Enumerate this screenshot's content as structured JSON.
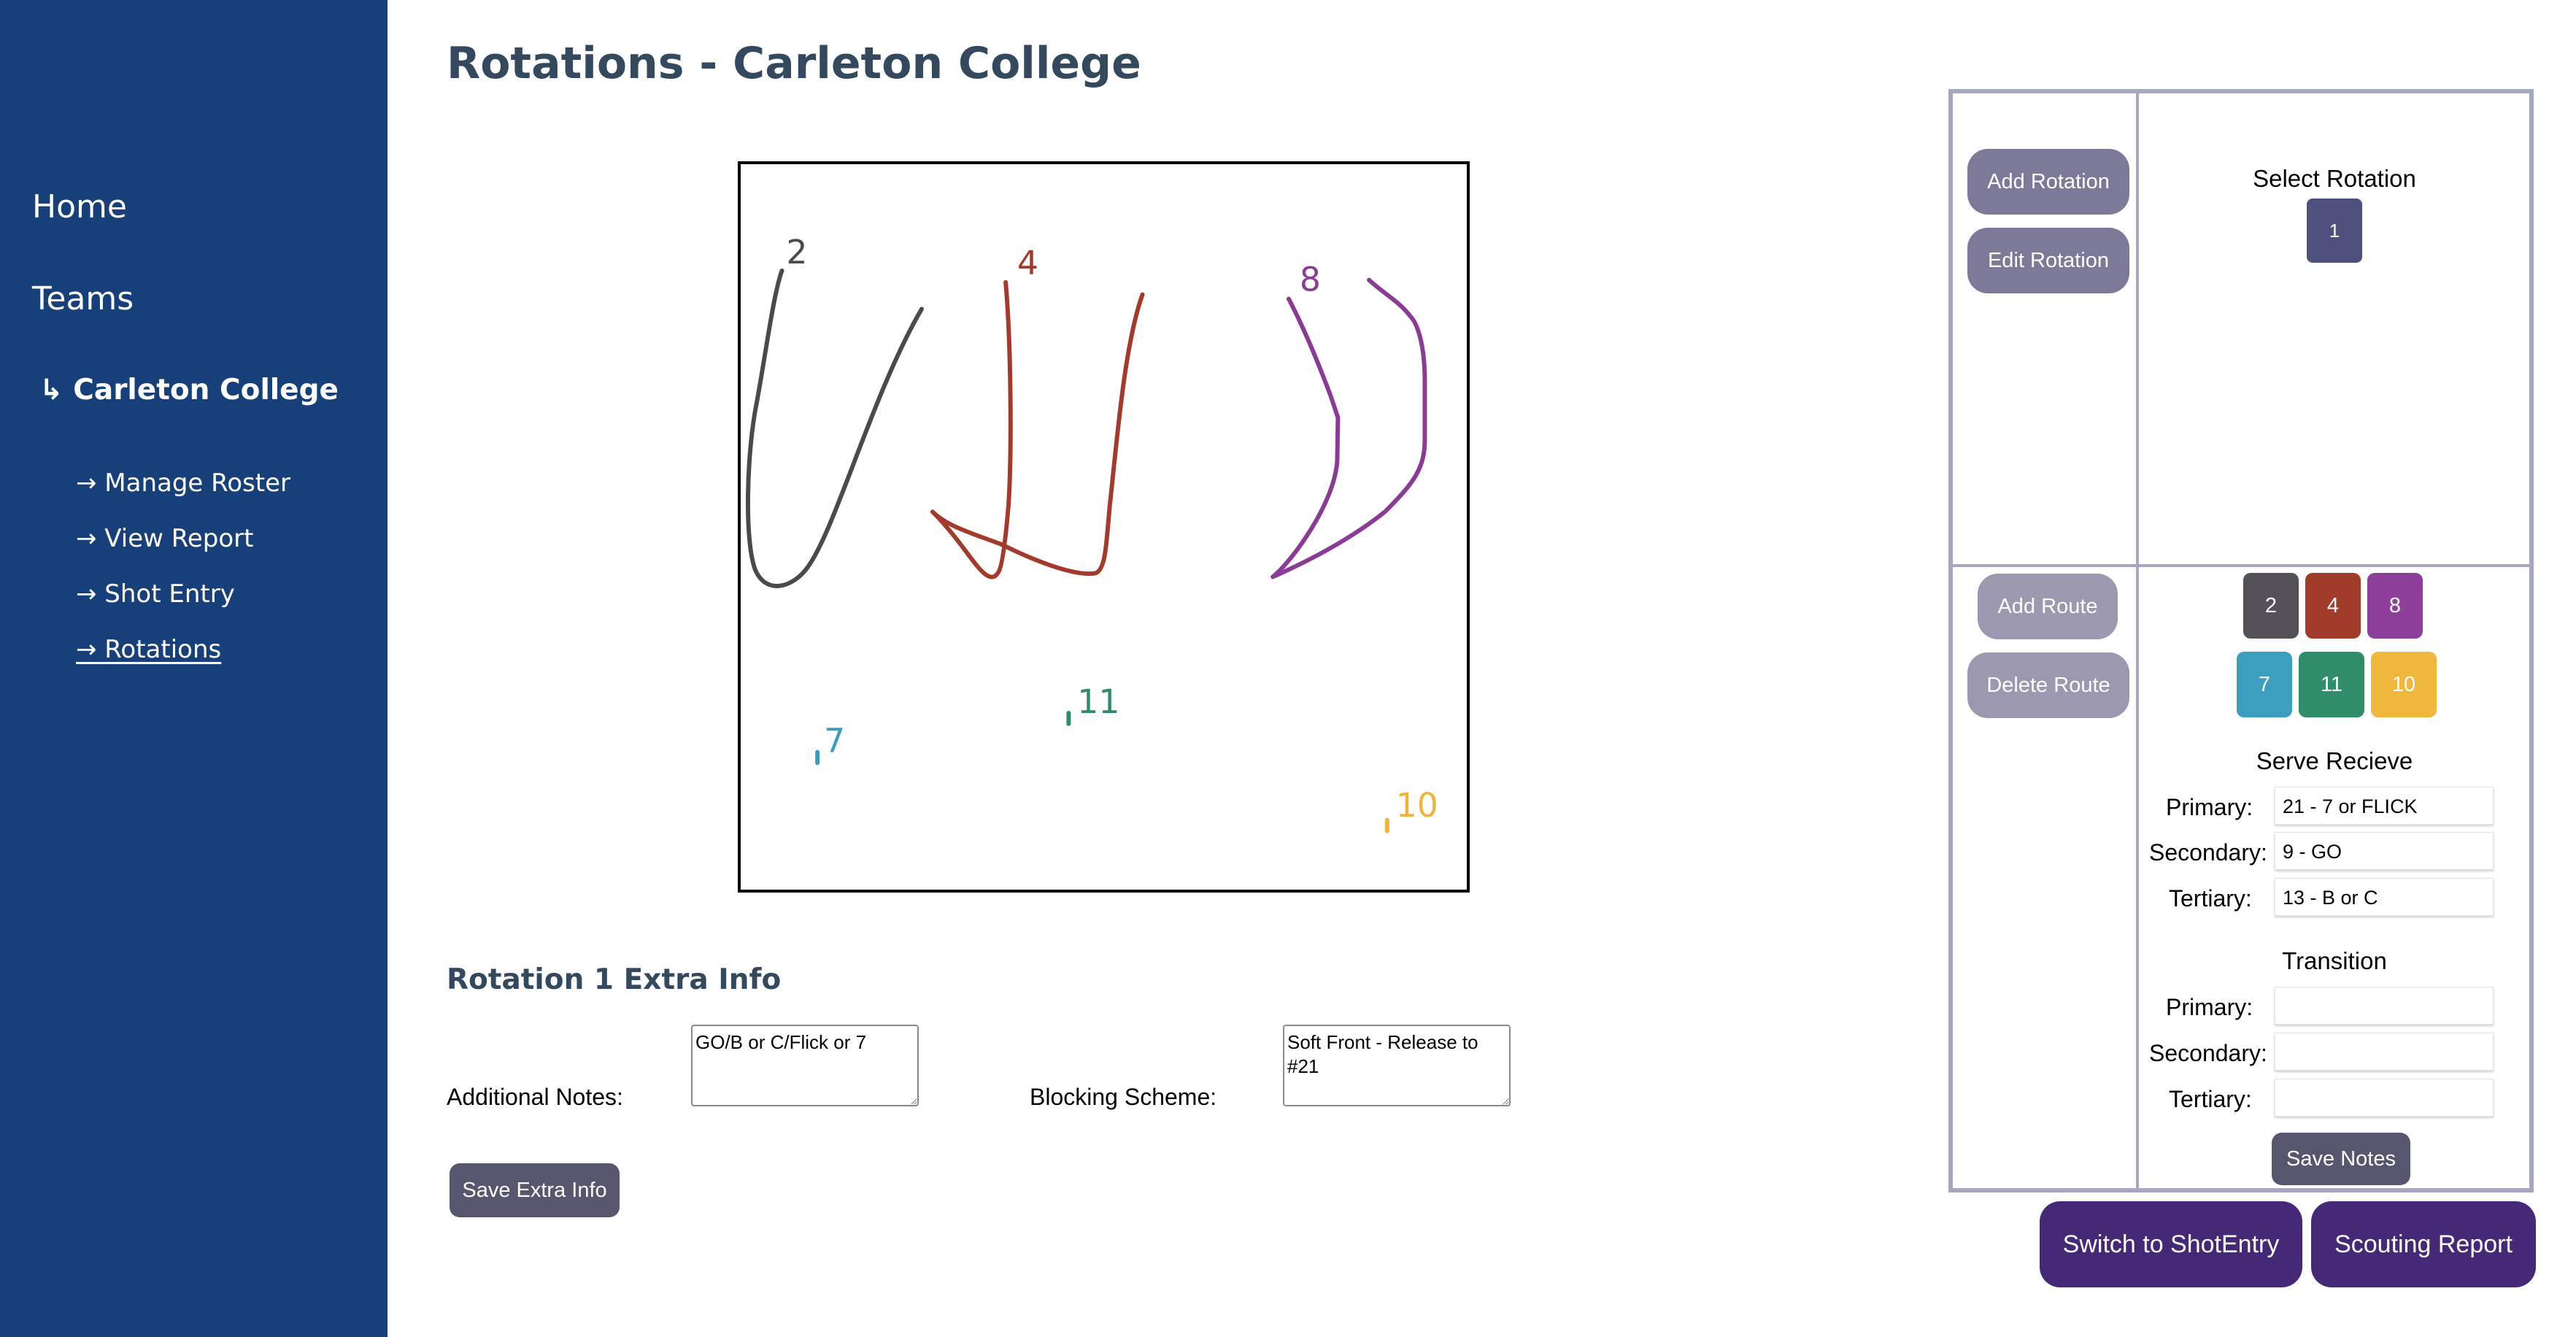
{
  "sidebar": {
    "home": "Home",
    "teams": "Teams",
    "team_name": "↳ Carleton College",
    "links": [
      {
        "label": "→ Manage Roster"
      },
      {
        "label": "→ View Report"
      },
      {
        "label": "→ Shot Entry"
      },
      {
        "label": "→ Rotations"
      }
    ]
  },
  "page_title": "Rotations - Carleton College",
  "court": {
    "players": [
      {
        "number": "2",
        "color": "#4a4a4a"
      },
      {
        "number": "4",
        "color": "#a33a2c"
      },
      {
        "number": "8",
        "color": "#8b3b96"
      },
      {
        "number": "7",
        "color": "#3a9cbf"
      },
      {
        "number": "11",
        "color": "#2e8c6a"
      },
      {
        "number": "10",
        "color": "#f0b43a"
      }
    ]
  },
  "extra_info": {
    "title": "Rotation 1 Extra Info",
    "additional_notes_label": "Additional Notes:",
    "additional_notes_value": "GO/B or C/Flick or 7",
    "blocking_scheme_label": "Blocking Scheme:",
    "blocking_scheme_value": "Soft Front - Release to #21",
    "save_label": "Save Extra Info"
  },
  "panel": {
    "add_rotation": "Add Rotation",
    "edit_rotation": "Edit Rotation",
    "select_rotation": "Select Rotation",
    "rotations": [
      "1"
    ],
    "add_route": "Add Route",
    "delete_route": "Delete Route",
    "player_buttons": [
      {
        "number": "2",
        "color": "#545058"
      },
      {
        "number": "4",
        "color": "#a13c2a"
      },
      {
        "number": "8",
        "color": "#8e3f9b"
      },
      {
        "number": "7",
        "color": "#3d9fc0"
      },
      {
        "number": "11",
        "color": "#2f8d69"
      },
      {
        "number": "10",
        "color": "#efb83c"
      }
    ],
    "serve_receive": {
      "title": "Serve Recieve",
      "primary_label": "Primary:",
      "primary_value": "21 - 7 or FLICK",
      "secondary_label": "Secondary:",
      "secondary_value": "9 - GO",
      "tertiary_label": "Tertiary:",
      "tertiary_value": "13 - B or C"
    },
    "transition": {
      "title": "Transition",
      "primary_label": "Primary:",
      "primary_value": "",
      "secondary_label": "Secondary:",
      "secondary_value": "",
      "tertiary_label": "Tertiary:",
      "tertiary_value": ""
    },
    "save_notes": "Save Notes"
  },
  "footer": {
    "switch_shot_entry": "Switch to ShotEntry",
    "scouting_report": "Scouting Report"
  }
}
